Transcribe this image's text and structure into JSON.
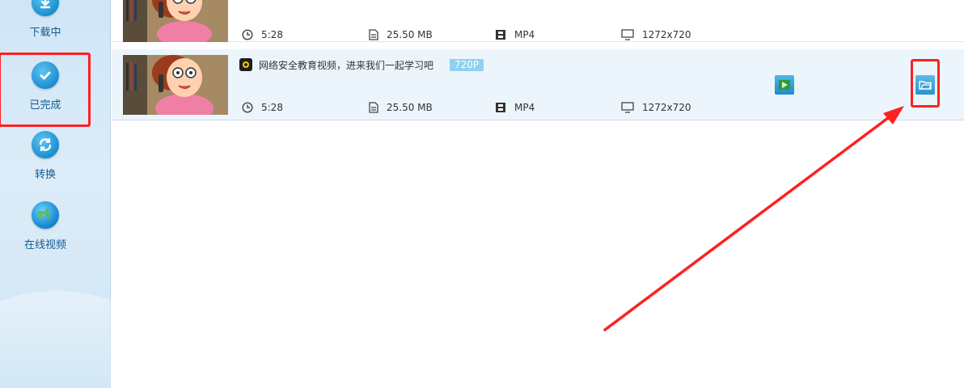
{
  "sidebar": {
    "items": [
      {
        "label": "下载中",
        "icon": "download-icon"
      },
      {
        "label": "已完成",
        "icon": "check-icon",
        "active": true
      },
      {
        "label": "转换",
        "icon": "convert-icon"
      },
      {
        "label": "在线视频",
        "icon": "globe-icon"
      }
    ]
  },
  "list": {
    "rows": [
      {
        "duration": "5:28",
        "size": "25.50 MB",
        "format": "MP4",
        "resolution": "1272x720"
      },
      {
        "title": "网络安全教育视频，进来我们一起学习吧",
        "quality": "720P",
        "duration": "5:28",
        "size": "25.50 MB",
        "format": "MP4",
        "resolution": "1272x720"
      }
    ]
  },
  "actions": {
    "play_icon": "play-icon",
    "folder_icon": "open-folder-icon"
  },
  "annotation": {
    "color": "#ff2020"
  }
}
